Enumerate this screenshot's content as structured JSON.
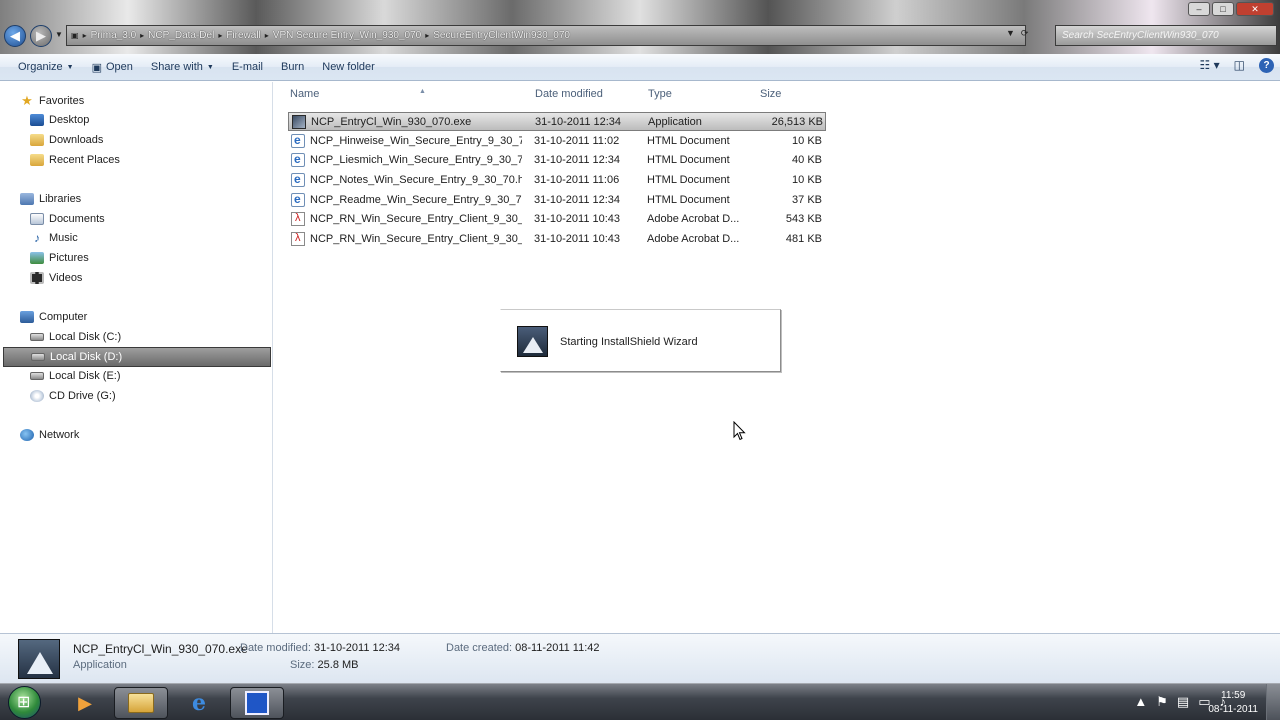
{
  "window": {
    "breadcrumbs": [
      "Prima_3.0",
      "NCP_Data-Del",
      "Firewall",
      "VPN Secure Entry_Win_930_070",
      "SecureEntryClientWin930_070"
    ],
    "search_placeholder": "Search SecEntryClientWin930_070"
  },
  "toolbar": {
    "organize": "Organize",
    "open": "Open",
    "share_with": "Share with",
    "email": "E-mail",
    "burn": "Burn",
    "new_folder": "New folder"
  },
  "nav": {
    "favorites": "Favorites",
    "desktop": "Desktop",
    "downloads": "Downloads",
    "recent_places": "Recent Places",
    "libraries": "Libraries",
    "documents": "Documents",
    "music": "Music",
    "pictures": "Pictures",
    "videos": "Videos",
    "computer": "Computer",
    "disk_c": "Local Disk (C:)",
    "disk_d": "Local Disk (D:)",
    "disk_e": "Local Disk (E:)",
    "cd_drive": "CD Drive (G:)",
    "network": "Network"
  },
  "columns": {
    "name": "Name",
    "date_modified": "Date modified",
    "type": "Type",
    "size": "Size"
  },
  "files": [
    {
      "name": "NCP_EntryCl_Win_930_070.exe",
      "date": "31-10-2011 12:34",
      "type": "Application",
      "size": "26,513 KB",
      "icon": "exe-icon"
    },
    {
      "name": "NCP_Hinweise_Win_Secure_Entry_9_30_7...",
      "date": "31-10-2011 11:02",
      "type": "HTML Document",
      "size": "10 KB",
      "icon": "html-icon"
    },
    {
      "name": "NCP_Liesmich_Win_Secure_Entry_9_30_7...",
      "date": "31-10-2011 12:34",
      "type": "HTML Document",
      "size": "40 KB",
      "icon": "html-icon"
    },
    {
      "name": "NCP_Notes_Win_Secure_Entry_9_30_70.ht...",
      "date": "31-10-2011 11:06",
      "type": "HTML Document",
      "size": "10 KB",
      "icon": "html-icon"
    },
    {
      "name": "NCP_Readme_Win_Secure_Entry_9_30_70....",
      "date": "31-10-2011 12:34",
      "type": "HTML Document",
      "size": "37 KB",
      "icon": "html-icon"
    },
    {
      "name": "NCP_RN_Win_Secure_Entry_Client_9_30_...",
      "date": "31-10-2011 10:43",
      "type": "Adobe Acrobat D...",
      "size": "543 KB",
      "icon": "pdf-icon"
    },
    {
      "name": "NCP_RN_Win_Secure_Entry_Client_9_30_...",
      "date": "31-10-2011 10:43",
      "type": "Adobe Acrobat D...",
      "size": "481 KB",
      "icon": "pdf-icon"
    }
  ],
  "installshield": {
    "message": "Starting InstallShield Wizard"
  },
  "details": {
    "name": "NCP_EntryCl_Win_930_070.exe",
    "type": "Application",
    "date_modified_label": "Date modified:",
    "date_modified": "31-10-2011 12:34",
    "size_label": "Size:",
    "size": "25.8 MB",
    "date_created_label": "Date created:",
    "date_created": "08-11-2011 11:42"
  },
  "taskbar": {
    "time": "11:59",
    "date": "08-11-2011"
  }
}
